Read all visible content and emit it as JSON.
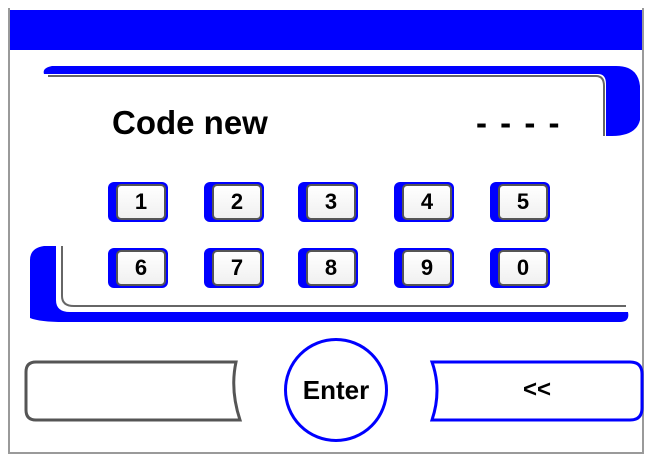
{
  "header": {
    "color": "#0000ff"
  },
  "display": {
    "label": "Code new",
    "code_value": "- - - -"
  },
  "keypad": {
    "keys": [
      "1",
      "2",
      "3",
      "4",
      "5",
      "6",
      "7",
      "8",
      "9",
      "0"
    ]
  },
  "actions": {
    "left_label": "",
    "enter_label": "Enter",
    "back_label": "<<"
  },
  "colors": {
    "accent": "#0000ff",
    "outline": "#555555"
  }
}
